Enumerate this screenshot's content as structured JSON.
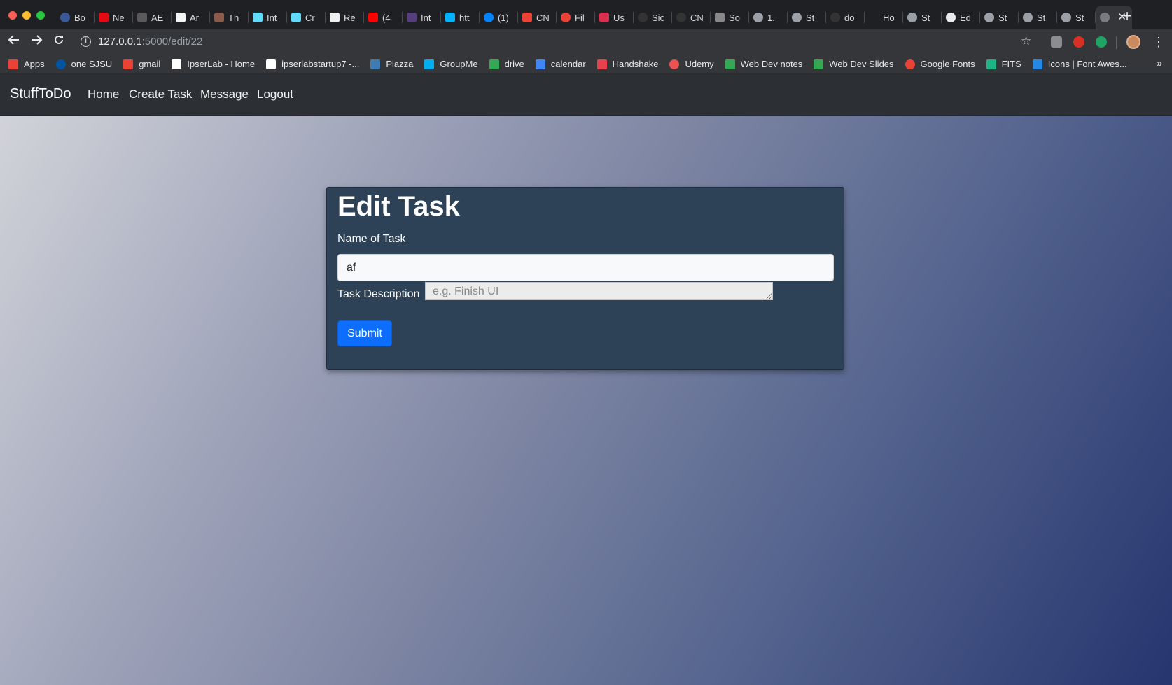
{
  "browser": {
    "tabs": [
      {
        "label": "Bo",
        "icon": "globe-icon",
        "color": "#3b5998"
      },
      {
        "label": "Ne",
        "icon": "netflix-icon",
        "color": "#e50914"
      },
      {
        "label": "AE",
        "icon": "ae-icon",
        "color": "#5a5a5a"
      },
      {
        "label": "Ar",
        "icon": "amazon-icon",
        "color": "#f5f5f5"
      },
      {
        "label": "Th",
        "icon": "image-icon",
        "color": "#8b5a4a"
      },
      {
        "label": "Int",
        "icon": "react-icon",
        "color": "#61dafb"
      },
      {
        "label": "Cr",
        "icon": "react-icon",
        "color": "#61dafb"
      },
      {
        "label": "Re",
        "icon": "codepen-icon",
        "color": "#f0f0f0"
      },
      {
        "label": "(4",
        "icon": "youtube-icon",
        "color": "#ff0000"
      },
      {
        "label": "Int",
        "icon": "bootstrap-icon",
        "color": "#563d7c"
      },
      {
        "label": "htt",
        "icon": "link-icon",
        "color": "#00b2ff"
      },
      {
        "label": "(1)",
        "icon": "messenger-icon",
        "color": "#0084ff"
      },
      {
        "label": "CN",
        "icon": "gmail-icon",
        "color": "#ea4335"
      },
      {
        "label": "Fil",
        "icon": "spinner-icon",
        "color": "#ea4335"
      },
      {
        "label": "Us",
        "icon": "w-icon",
        "color": "#d9304f"
      },
      {
        "label": "Sic",
        "icon": "github-icon",
        "color": "#333333"
      },
      {
        "label": "CN",
        "icon": "github-icon",
        "color": "#333333"
      },
      {
        "label": "So",
        "icon": "doc-icon",
        "color": "#888888"
      },
      {
        "label": "1.",
        "icon": "globe-icon",
        "color": "#9aa0a6"
      },
      {
        "label": "St",
        "icon": "globe-icon",
        "color": "#9aa0a6"
      },
      {
        "label": "do",
        "icon": "github-icon",
        "color": "#333333"
      },
      {
        "label": "Ho",
        "icon": "blank-icon",
        "color": "#1f2023"
      },
      {
        "label": "St",
        "icon": "globe-icon",
        "color": "#9aa0a6"
      },
      {
        "label": "Ed",
        "icon": "globe-icon",
        "color": "#e8eaed"
      },
      {
        "label": "St",
        "icon": "globe-icon",
        "color": "#9aa0a6"
      },
      {
        "label": "St",
        "icon": "globe-icon",
        "color": "#9aa0a6"
      },
      {
        "label": "St",
        "icon": "globe-icon",
        "color": "#9aa0a6"
      }
    ],
    "active_tab_close": "✕",
    "new_tab": "+",
    "url_host": "127.0.0.1",
    "url_path": ":5000/edit/22",
    "bookmarks": [
      {
        "label": "Apps",
        "icon": "apps-grid-icon",
        "color": "#ea4335"
      },
      {
        "label": "one SJSU",
        "icon": "sjsu-icon",
        "color": "#0055a2"
      },
      {
        "label": "gmail",
        "icon": "gmail-icon",
        "color": "#ea4335"
      },
      {
        "label": "IpserLab - Home",
        "icon": "page-icon",
        "color": "#ffffff"
      },
      {
        "label": "ipserlabstartup7 -...",
        "icon": "page-icon",
        "color": "#ffffff"
      },
      {
        "label": "Piazza",
        "icon": "piazza-icon",
        "color": "#3e7cb1"
      },
      {
        "label": "GroupMe",
        "icon": "groupme-icon",
        "color": "#00aff0"
      },
      {
        "label": "drive",
        "icon": "drive-icon",
        "color": "#34a853"
      },
      {
        "label": "calendar",
        "icon": "calendar-icon",
        "color": "#4285f4"
      },
      {
        "label": "Handshake",
        "icon": "handshake-icon",
        "color": "#e8414c"
      },
      {
        "label": "Udemy",
        "icon": "udemy-icon",
        "color": "#ec5252"
      },
      {
        "label": "Web Dev notes",
        "icon": "drive-icon",
        "color": "#34a853"
      },
      {
        "label": "Web Dev Slides",
        "icon": "drive-icon",
        "color": "#34a853"
      },
      {
        "label": "Google Fonts",
        "icon": "google-fonts-icon",
        "color": "#ea4335"
      },
      {
        "label": "FITS",
        "icon": "fits-icon",
        "color": "#1db584"
      },
      {
        "label": "Icons | Font Awes...",
        "icon": "font-awesome-icon",
        "color": "#228ae6"
      }
    ],
    "bookmarks_more": "»"
  },
  "app": {
    "brand": "StuffToDo",
    "nav": {
      "home": "Home",
      "create": "Create Task",
      "message": "Message",
      "logout": "Logout"
    }
  },
  "form": {
    "title": "Edit Task",
    "name_label": "Name of Task",
    "name_value": "af",
    "desc_label": "Task Description",
    "desc_placeholder": "e.g. Finish UI",
    "submit_label": "Submit"
  },
  "colors": {
    "navbar": "#2c3035",
    "card": "#2d4157",
    "primary": "#0d6efd"
  }
}
